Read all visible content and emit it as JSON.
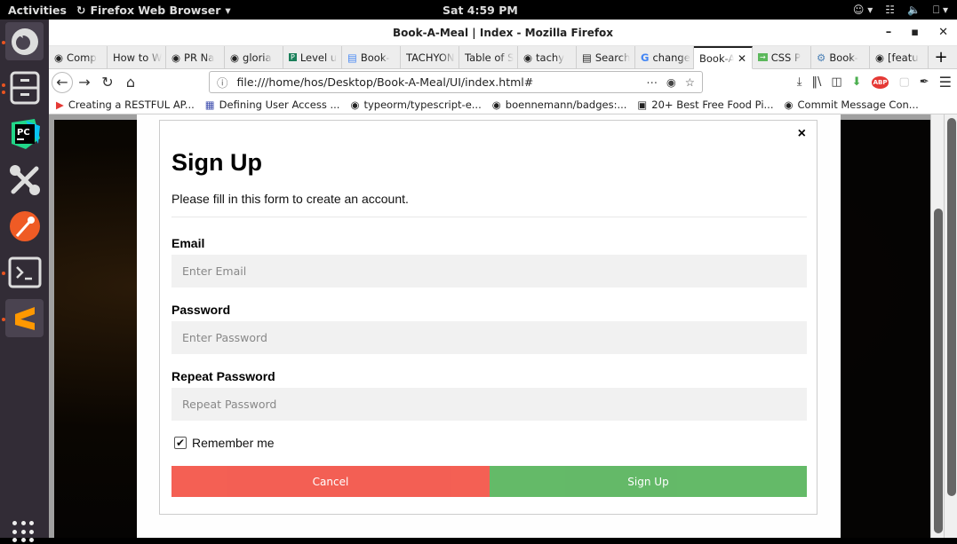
{
  "system": {
    "activities": "Activities",
    "app_name": "Firefox Web Browser",
    "clock": "Sat  4:59 PM"
  },
  "dock": {
    "items": [
      {
        "name": "firefox",
        "running": true
      },
      {
        "name": "files",
        "running": true
      },
      {
        "name": "pycharm",
        "running": false
      },
      {
        "name": "settings-tools",
        "running": false
      },
      {
        "name": "postman",
        "running": false
      },
      {
        "name": "terminal",
        "running": true
      },
      {
        "name": "sublime-text",
        "running": true
      }
    ]
  },
  "window": {
    "title": "Book-A-Meal | Index - Mozilla Firefox"
  },
  "tabs": [
    {
      "label": "Comp",
      "icon": "github"
    },
    {
      "label": "How to W",
      "icon": ""
    },
    {
      "label": "PR Na",
      "icon": "github"
    },
    {
      "label": "gloria",
      "icon": "github"
    },
    {
      "label": "Level u",
      "icon": "pluralsight"
    },
    {
      "label": "Book-",
      "icon": "docs"
    },
    {
      "label": "TACHYON",
      "icon": ""
    },
    {
      "label": "Table of S",
      "icon": ""
    },
    {
      "label": "tachy",
      "icon": "github"
    },
    {
      "label": "Search",
      "icon": "reader"
    },
    {
      "label": "change",
      "icon": "google"
    },
    {
      "label": "Book-A",
      "icon": "",
      "active": true
    },
    {
      "label": "CSS P",
      "icon": "css"
    },
    {
      "label": "Book-",
      "icon": "web"
    },
    {
      "label": "[featu",
      "icon": "github"
    }
  ],
  "navbar": {
    "url": "file:///home/hos/Desktop/Book-A-Meal/UI/index.html#"
  },
  "bookmarks": [
    {
      "label": "Creating a RESTFUL AP...",
      "icon": "youtube"
    },
    {
      "label": "Defining User Access ...",
      "icon": "page"
    },
    {
      "label": "typeorm/typescript-e...",
      "icon": "github"
    },
    {
      "label": "boennemann/badges:...",
      "icon": "github"
    },
    {
      "label": "20+ Best Free Food Pi...",
      "icon": "camera"
    },
    {
      "label": "Commit Message Con...",
      "icon": "github"
    }
  ],
  "form": {
    "close": "×",
    "title": "Sign Up",
    "subtitle": "Please fill in this form to create an account.",
    "email_label": "Email",
    "email_placeholder": "Enter Email",
    "password_label": "Password",
    "password_placeholder": "Enter Password",
    "repeat_label": "Repeat Password",
    "repeat_placeholder": "Repeat Password",
    "remember_label": "Remember me",
    "remember_checked": true,
    "cancel_label": "Cancel",
    "signup_label": "Sign Up",
    "cancel_color": "#f3574b",
    "signup_color": "#5cb660"
  }
}
